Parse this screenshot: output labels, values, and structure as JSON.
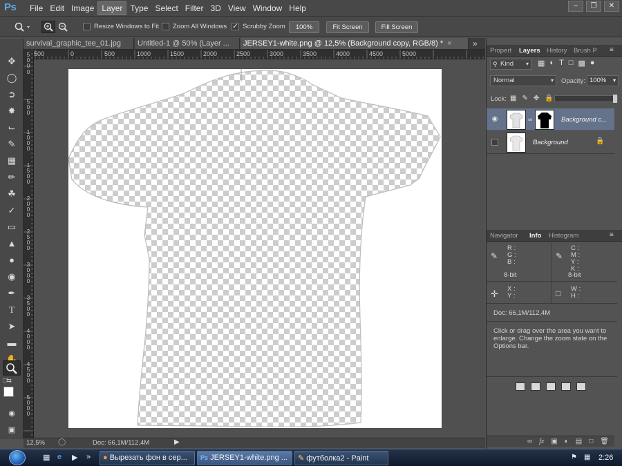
{
  "app": {
    "logo": "Ps"
  },
  "menu": [
    "File",
    "Edit",
    "Image",
    "Layer",
    "Type",
    "Select",
    "Filter",
    "3D",
    "View",
    "Window",
    "Help"
  ],
  "menu_active": "Layer",
  "window_controls": [
    "minimize",
    "restore",
    "close"
  ],
  "options": {
    "resize_windows": "Resize Windows to Fit",
    "zoom_all": "Zoom All Windows",
    "scrubby_zoom": "Scrubby Zoom",
    "btn_100": "100%",
    "fit_screen": "Fit Screen",
    "fill_screen": "Fill Screen"
  },
  "tools": [
    "move-tool",
    "marquee-tool",
    "lasso-tool",
    "quick-select-tool",
    "crop-tool",
    "eyedropper-tool",
    "healing-brush-tool",
    "brush-tool",
    "clone-stamp-tool",
    "history-brush-tool",
    "eraser-tool",
    "paint-bucket-tool",
    "blur-tool",
    "dodge-tool",
    "pen-tool",
    "type-tool",
    "path-select-tool",
    "rectangle-tool",
    "hand-tool",
    "zoom-tool"
  ],
  "tabs": [
    {
      "label": "survival_graphic_tee_01.jpg"
    },
    {
      "label": "Untitled-1 @ 50% (Layer ..."
    },
    {
      "label": "JERSEY1-white.png @ 12,5% (Background copy, RGB/8) *"
    }
  ],
  "tabs_overflow": "»",
  "ruler": {
    "h": [
      "500",
      "0",
      "500",
      "1000",
      "1500",
      "2000",
      "2500",
      "3000",
      "3500",
      "4000",
      "4500",
      "5000"
    ],
    "v": [
      "5\n0\n0",
      "0",
      "5\n0\n0",
      "1\n0\n0\n0",
      "1\n5\n0\n0",
      "2\n0\n0\n0",
      "2\n5\n0\n0",
      "3\n0\n0\n0",
      "3\n5\n0\n0",
      "4\n0\n0\n0",
      "4\n5\n0\n0",
      "5\n0\n0\n0"
    ]
  },
  "status": {
    "zoom": "12,5%",
    "doc": "Doc: 66,1M/112,4M"
  },
  "layers_panel": {
    "tabs": [
      "Propert",
      "Layers",
      "History",
      "Brush P"
    ],
    "active_tab": "Layers",
    "kind": "Kind",
    "blend_mode": "Normal",
    "opacity_label": "Opacity:",
    "opacity_value": "100%",
    "lock_label": "Lock:",
    "layers": [
      {
        "name": "Background c...",
        "visible": true,
        "selected": true
      },
      {
        "name": "Background",
        "visible": false,
        "selected": false
      }
    ]
  },
  "info_panel": {
    "tabs": [
      "Navigator",
      "Info",
      "Histogram"
    ],
    "active_tab": "Info",
    "rgb_labels": "R :\nG :\nB :",
    "cmyk_labels": "C :\nM :\nY :\nK :",
    "bit_left": "8-bit",
    "bit_right": "8-bit",
    "xy_labels": "X :\nY :",
    "wh_labels": "W :\nH :",
    "doc": "Doc: 66,1M/112,4M",
    "hint": "Click or drag over the area you want to enlarge. Change the zoom state on the Options bar."
  },
  "taskbar": {
    "tasks": [
      {
        "label": "Вырезать фон в сер...",
        "icon": "firefox-icon"
      },
      {
        "label": "JERSEY1-white.png ...",
        "icon": "photoshop-icon"
      },
      {
        "label": "футболка2 - Paint",
        "icon": "paint-icon"
      }
    ],
    "clock": "2:26"
  }
}
